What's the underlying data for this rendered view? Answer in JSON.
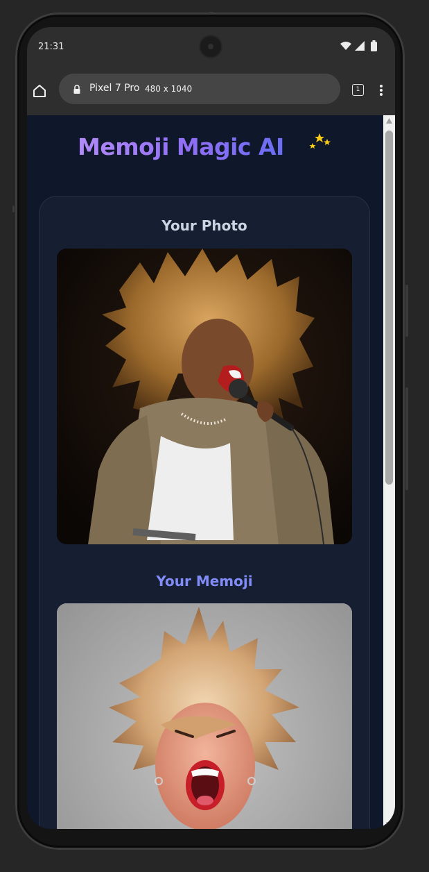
{
  "device": {
    "status_time": "21:31",
    "browser": {
      "device_name": "Pixel 7 Pro",
      "dimensions": "480 x 1040",
      "tab_count": "1"
    }
  },
  "app": {
    "title": "Memoji Magic AI",
    "title_gradient": [
      "#a78bfa",
      "#8b5cf6",
      "#6366f1"
    ],
    "sparkle_color": "#facc15",
    "sections": [
      {
        "title": "Your Photo",
        "title_color": "#cbd5e1"
      },
      {
        "title": "Your Memoji",
        "title_color": "#818cf8"
      }
    ]
  },
  "colors": {
    "page_background": "#0f172a",
    "card_background": "#161e31"
  },
  "icons": [
    "home-icon",
    "lock-icon",
    "tab-switcher-icon",
    "more-vert-icon",
    "wifi-icon",
    "signal-icon",
    "battery-icon",
    "sparkles-icon"
  ]
}
